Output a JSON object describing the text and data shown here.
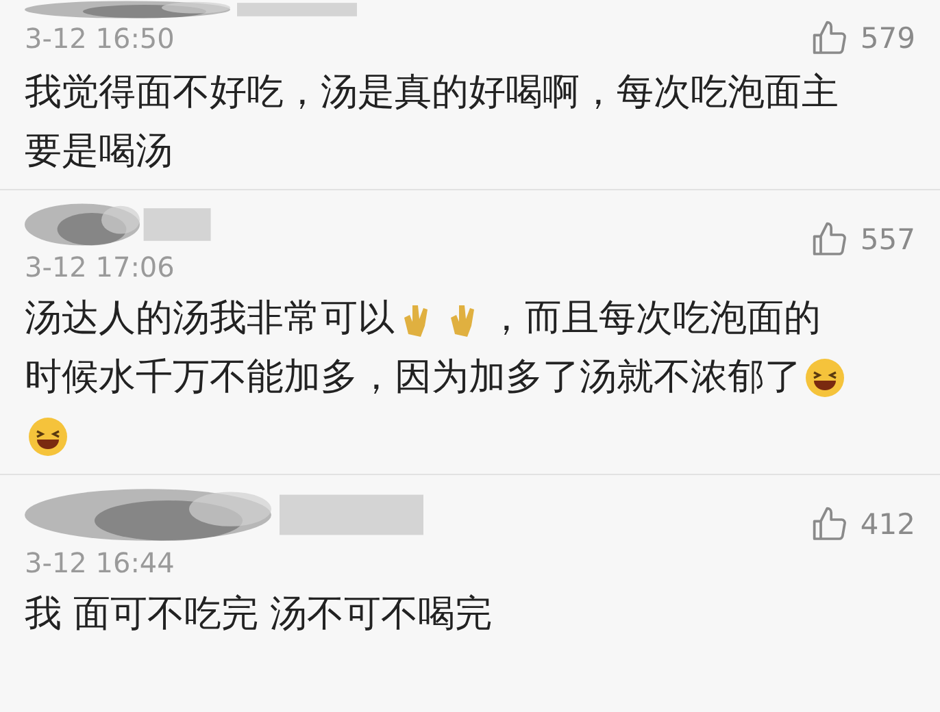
{
  "comments": [
    {
      "time": "3-12 16:50",
      "likes": "579",
      "lines": [
        [
          {
            "kind": "text",
            "text": "我觉得面不好吃，汤是真的好喝啊，每次吃泡面主"
          }
        ],
        [
          {
            "kind": "text",
            "text": "要是喝汤"
          }
        ]
      ]
    },
    {
      "time": "3-12 17:06",
      "likes": "557",
      "lines": [
        [
          {
            "kind": "text",
            "text": "汤达人的汤我非常可以"
          },
          {
            "kind": "clap"
          },
          {
            "kind": "clap"
          },
          {
            "kind": "text",
            "text": "，而且每次吃泡面的"
          }
        ],
        [
          {
            "kind": "text",
            "text": "时候水千万不能加多，因为加多了汤就不浓郁了"
          },
          {
            "kind": "laugh"
          }
        ],
        [
          {
            "kind": "laugh"
          }
        ]
      ]
    },
    {
      "time": "3-12 16:44",
      "likes": "412",
      "lines": [
        [
          {
            "kind": "text",
            "text": "我 面可不吃完 汤不可不喝完"
          }
        ]
      ]
    }
  ]
}
